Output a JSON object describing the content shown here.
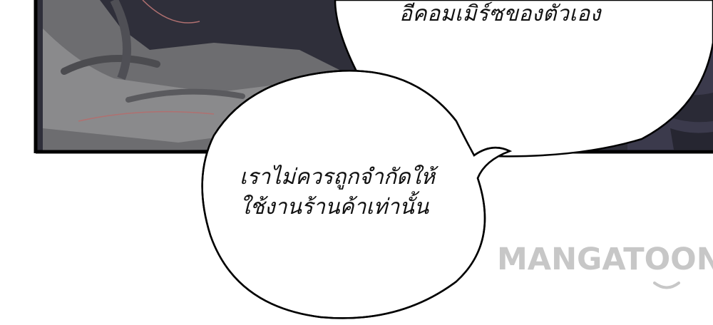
{
  "bubbles": {
    "top_text": "อีคอมเมิร์ซของตัวเอง",
    "lower_line1": "เราไม่ควรถูกจำกัดให้",
    "lower_line2": "ใช้งานร้านค้าเท่านั้น"
  },
  "watermark": {
    "text": "MANGATOON"
  },
  "colors": {
    "panel_border": "#000000",
    "panel_bg": "#3a3a44",
    "bubble_fill": "#ffffff",
    "watermark": "#c7c7c7"
  }
}
